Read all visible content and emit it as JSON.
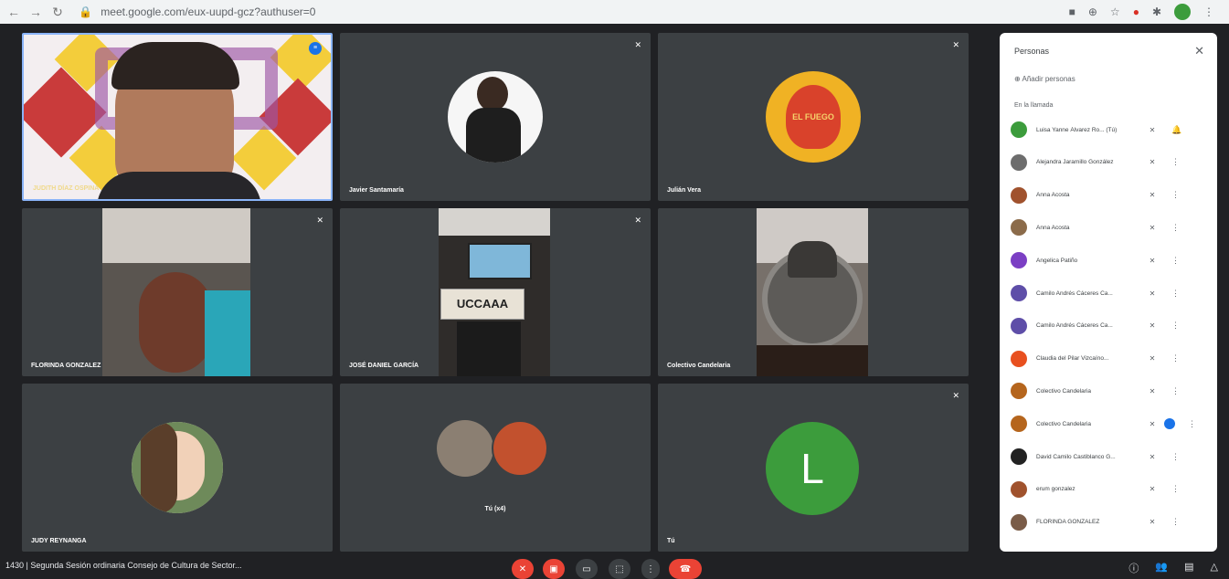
{
  "browser": {
    "url": "meet.google.com/eux-uupd-gcz?authuser=0",
    "back_icon": "←",
    "forward_icon": "→",
    "reload_icon": "↻"
  },
  "tiles": [
    {
      "name": "JUDITH DÍAZ OSPINA",
      "label_bound": true
    },
    {
      "name": "Javier Santamaría"
    },
    {
      "name": "Julián Vera"
    },
    {
      "name": "FLORINDA GONZALEZ"
    },
    {
      "name": "JOSÉ DANIEL GARCÍA"
    },
    {
      "name": "Colectivo Candelaria"
    },
    {
      "name": "JUDY REYNANGA"
    },
    {
      "name": "Tú (x4)"
    },
    {
      "name": "Tú"
    }
  ],
  "tile_letter": "L",
  "avatar_text": "EL FUEGO",
  "sign_text": "UCCAAA",
  "panel": {
    "title": "Personas",
    "close": "✕",
    "add": "Añadir personas",
    "section": "En la llamada",
    "participants": [
      {
        "name": "Luisa Yanne Álvarez Ro... (Tú)",
        "color": "#3c9c3c"
      },
      {
        "name": "Alejandra Jaramillo González",
        "color": "#6d6d6d"
      },
      {
        "name": "Anna Acosta",
        "color": "#a0522d"
      },
      {
        "name": "Anna Acosta",
        "color": "#8b6b4a"
      },
      {
        "name": "Angelica Patiño",
        "color": "#7b3fc4"
      },
      {
        "name": "Camilo Andrés Cáceres Ca...",
        "color": "#5e4ea8"
      },
      {
        "name": "Camilo Andrés Cáceres Ca...",
        "color": "#5e4ea8"
      },
      {
        "name": "Claudia del Pilar Vizcaíno...",
        "color": "#e8501f"
      },
      {
        "name": "Colectivo Candelaria",
        "color": "#b5651d"
      },
      {
        "name": "Colectivo Candelaria",
        "color": "#b5651d"
      },
      {
        "name": "David Camilo Castiblanco G...",
        "color": "#222222"
      },
      {
        "name": "erum gonzalez",
        "color": "#a0522d"
      },
      {
        "name": "FLORINDA GONZALEZ",
        "color": "#7a5c48"
      }
    ]
  },
  "bottom": {
    "meeting_title": "1430 | Segunda Sesión ordinaria Consejo de Cultura de Sector..."
  },
  "icons": {
    "mic_off": "mic-off-icon",
    "more": "more-vert-icon"
  }
}
